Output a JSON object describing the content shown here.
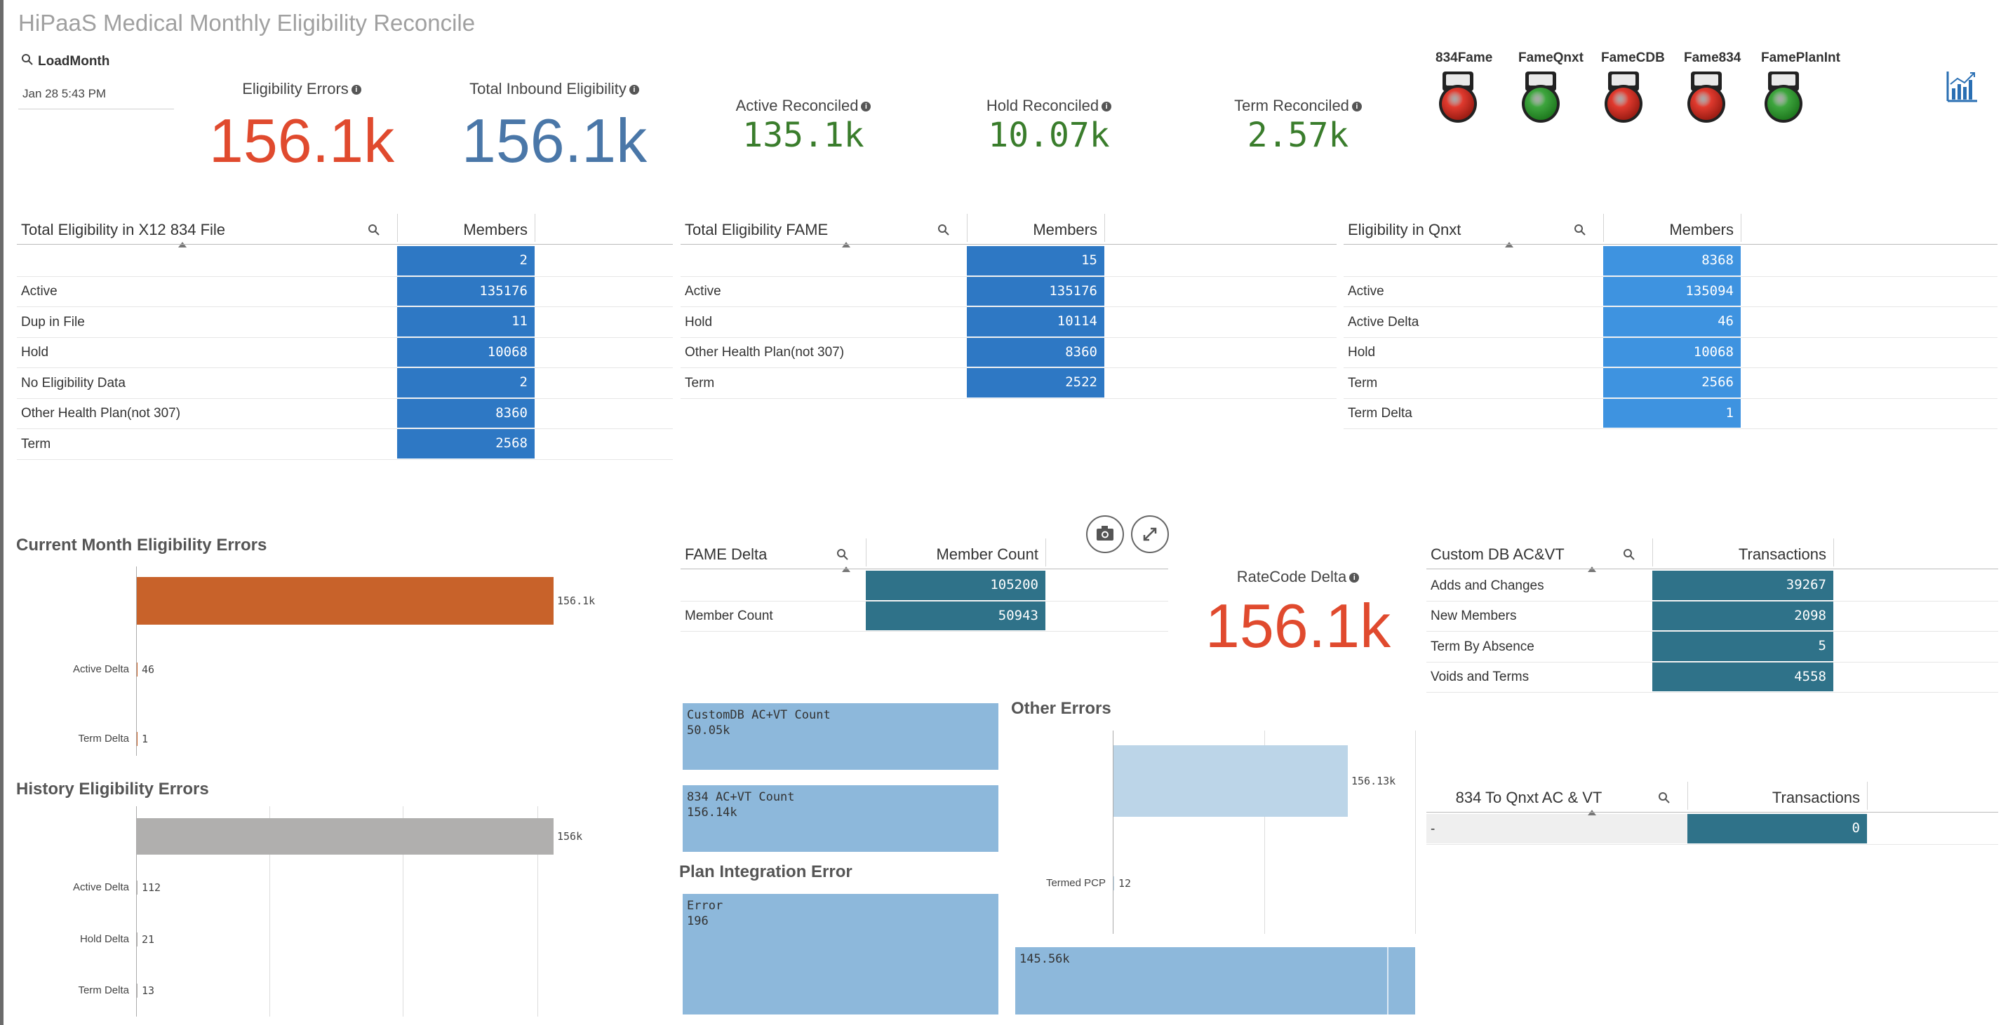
{
  "app": {
    "title": "HiPaaS Medical Monthly Eligibility Reconcile"
  },
  "filter": {
    "label": "LoadMonth",
    "value": "Jan 28 5:43 PM"
  },
  "kpis": {
    "eligibility_errors": {
      "label": "Eligibility Errors",
      "value": "156.1k",
      "color": "#e04a2e"
    },
    "total_inbound": {
      "label": "Total Inbound Eligibility",
      "value": "156.1k",
      "color": "#4a77a8"
    },
    "active_reconciled": {
      "label": "Active Reconciled",
      "value": "135.1k",
      "color": "#3a7d2c"
    },
    "hold_reconciled": {
      "label": "Hold Reconciled",
      "value": "10.07k",
      "color": "#3a7d2c"
    },
    "term_reconciled": {
      "label": "Term Reconciled",
      "value": "2.57k",
      "color": "#3a7d2c"
    },
    "ratecode_delta": {
      "label": "RateCode Delta",
      "value": "156.1k",
      "color": "#e04a2e"
    }
  },
  "lights": [
    {
      "label": "834Fame",
      "status": "red"
    },
    {
      "label": "FameQnxt",
      "status": "green"
    },
    {
      "label": "FameCDB",
      "status": "red"
    },
    {
      "label": "Fame834",
      "status": "red"
    },
    {
      "label": "FamePlanInt",
      "status": "green"
    }
  ],
  "tables": {
    "x12": {
      "header": "Total Eligibility in X12 834 File",
      "col": "Members",
      "rows": [
        {
          "label": "",
          "value": "2"
        },
        {
          "label": "Active",
          "value": "135176"
        },
        {
          "label": "Dup in File",
          "value": "11"
        },
        {
          "label": "Hold",
          "value": "10068"
        },
        {
          "label": "No Eligibility Data",
          "value": "2"
        },
        {
          "label": "Other Health Plan(not 307)",
          "value": "8360"
        },
        {
          "label": "Term",
          "value": "2568"
        }
      ]
    },
    "fame": {
      "header": "Total Eligibility FAME",
      "col": "Members",
      "rows": [
        {
          "label": "",
          "value": "15"
        },
        {
          "label": "Active",
          "value": "135176"
        },
        {
          "label": "Hold",
          "value": "10114"
        },
        {
          "label": "Other Health Plan(not 307)",
          "value": "8360"
        },
        {
          "label": "Term",
          "value": "2522"
        }
      ]
    },
    "qnxt": {
      "header": "Eligibility in Qnxt",
      "col": "Members",
      "rows": [
        {
          "label": "",
          "value": "8368"
        },
        {
          "label": "Active",
          "value": "135094"
        },
        {
          "label": "Active Delta",
          "value": "46"
        },
        {
          "label": "Hold",
          "value": "10068"
        },
        {
          "label": "Term",
          "value": "2566"
        },
        {
          "label": "Term Delta",
          "value": "1"
        }
      ]
    },
    "fame_delta": {
      "header": "FAME Delta",
      "col": "Member Count",
      "rows": [
        {
          "label": "",
          "value": "105200"
        },
        {
          "label": "Member Count",
          "value": "50943"
        }
      ]
    },
    "custom_db": {
      "header": "Custom DB AC&VT",
      "col": "Transactions",
      "rows": [
        {
          "label": "Adds and Changes",
          "value": "39267"
        },
        {
          "label": "New Members",
          "value": "2098"
        },
        {
          "label": "Term By Absence",
          "value": "5"
        },
        {
          "label": "Voids and Terms",
          "value": "4558"
        }
      ]
    },
    "qnxt_acvt": {
      "header": "834 To Qnxt AC & VT",
      "col": "Transactions",
      "rows": [
        {
          "label": "-",
          "value": "0"
        }
      ]
    }
  },
  "current_errors": {
    "title": "Current Month Eligibility Errors",
    "bars": [
      {
        "label": "",
        "value": "156.1k",
        "color": "#c8622a"
      },
      {
        "label": "Active Delta",
        "value": "46"
      },
      {
        "label": "Term Delta",
        "value": "1"
      }
    ]
  },
  "history_errors": {
    "title": "History Eligibility Errors",
    "bars": [
      {
        "label": "",
        "value": "156k",
        "color": "#b0afae"
      },
      {
        "label": "Active Delta",
        "value": "112"
      },
      {
        "label": "Hold Delta",
        "value": "21"
      },
      {
        "label": "Term Delta",
        "value": "13"
      }
    ]
  },
  "treemap": {
    "box1": "CustomDB AC+VT Count\n50.05k",
    "box2": "834 AC+VT Count\n156.14k"
  },
  "plan_integration": {
    "title": "Plan Integration Error",
    "box": "Error\n196"
  },
  "other_errors": {
    "title": "Other Errors",
    "bars": [
      {
        "label": "",
        "value": "156.13k",
        "color": "#bcd5e8"
      },
      {
        "label": "Termed PCP",
        "value": "12"
      }
    ],
    "bottom_box": "145.56k"
  },
  "colors": {
    "table_blue": "#2e78c4",
    "table_lightblue": "#3e93e0",
    "table_teal": "#2f7289",
    "treemap": "#8db8db"
  },
  "chart_data": [
    {
      "type": "bar",
      "title": "Current Month Eligibility Errors",
      "categories": [
        "",
        "Active Delta",
        "Term Delta"
      ],
      "values": [
        156100,
        46,
        1
      ]
    },
    {
      "type": "bar",
      "title": "History Eligibility Errors",
      "categories": [
        "",
        "Active Delta",
        "Hold Delta",
        "Term Delta"
      ],
      "values": [
        156000,
        112,
        21,
        13
      ]
    },
    {
      "type": "bar",
      "title": "Other Errors",
      "categories": [
        "",
        "Termed PCP"
      ],
      "values": [
        156130,
        12
      ]
    }
  ]
}
